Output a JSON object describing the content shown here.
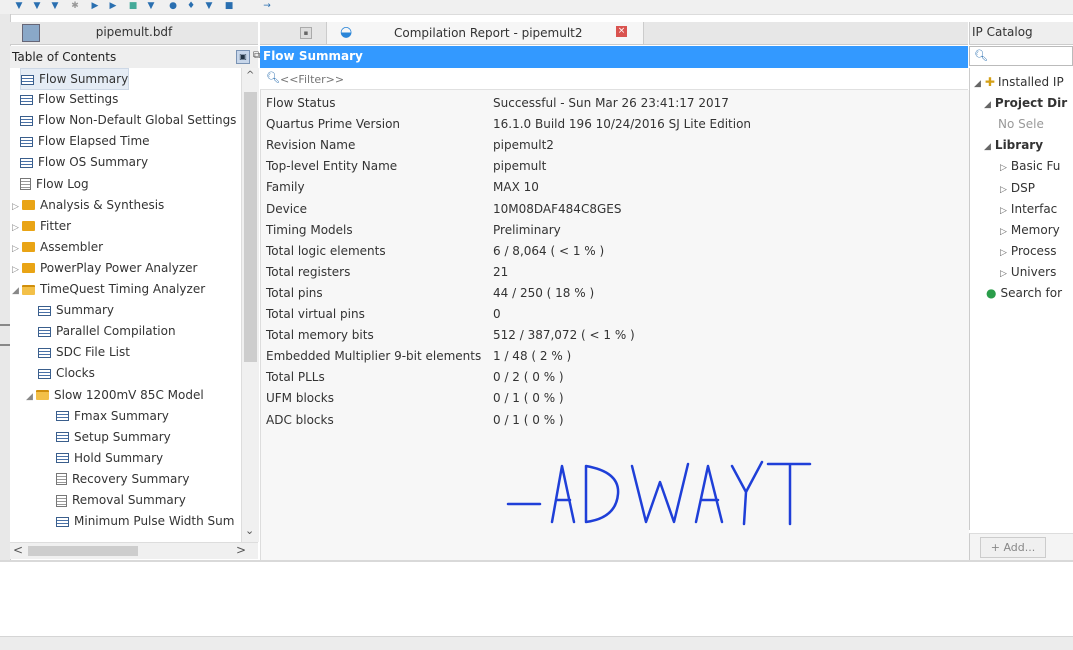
{
  "toolbar": {
    "icons": [
      "arrow-icon",
      "arrow-icon",
      "arrow-icon",
      "gear-icon",
      "play-icon",
      "play-icon",
      "chip-icon",
      "arrow-icon",
      "globe-icon",
      "pin-icon",
      "chart-icon",
      "save-icon",
      "arrow-icon"
    ]
  },
  "left_panel": {
    "tab_title": "pipemult.bdf",
    "toc_title": "Table of Contents",
    "items": [
      {
        "label": "Flow Summary",
        "icon": "table-icon",
        "selected": true
      },
      {
        "label": "Flow Settings",
        "icon": "table-icon"
      },
      {
        "label": "Flow Non-Default Global Settings",
        "icon": "table-icon"
      },
      {
        "label": "Flow Elapsed Time",
        "icon": "table-icon"
      },
      {
        "label": "Flow OS Summary",
        "icon": "table-icon"
      },
      {
        "label": "Flow Log",
        "icon": "document-icon"
      },
      {
        "label": "Analysis & Synthesis",
        "icon": "folder-icon",
        "arrow": "▷"
      },
      {
        "label": "Fitter",
        "icon": "folder-icon",
        "arrow": "▷"
      },
      {
        "label": "Assembler",
        "icon": "folder-icon",
        "arrow": "▷"
      },
      {
        "label": "PowerPlay Power Analyzer",
        "icon": "folder-icon",
        "arrow": "▷"
      },
      {
        "label": "TimeQuest Timing Analyzer",
        "icon": "folder-open-icon",
        "arrow": "◢"
      },
      {
        "label": "Summary",
        "icon": "table-icon"
      },
      {
        "label": "Parallel Compilation",
        "icon": "table-icon"
      },
      {
        "label": "SDC File List",
        "icon": "table-icon"
      },
      {
        "label": "Clocks",
        "icon": "table-icon"
      },
      {
        "label": "Slow 1200mV 85C Model",
        "icon": "folder-open-icon",
        "arrow": "◢"
      },
      {
        "label": "Fmax Summary",
        "icon": "table-icon"
      },
      {
        "label": "Setup Summary",
        "icon": "table-icon"
      },
      {
        "label": "Hold Summary",
        "icon": "table-icon"
      },
      {
        "label": "Recovery Summary",
        "icon": "document-icon"
      },
      {
        "label": "Removal Summary",
        "icon": "document-icon"
      },
      {
        "label": "Minimum Pulse Width Sum",
        "icon": "table-icon"
      }
    ]
  },
  "report": {
    "tab_title": "Compilation Report - pipemult2",
    "section_title": "Flow Summary",
    "filter_placeholder": "<<Filter>>",
    "rows": [
      {
        "key": "Flow Status",
        "value": "Successful - Sun Mar 26 23:41:17 2017"
      },
      {
        "key": "Quartus Prime Version",
        "value": "16.1.0 Build 196 10/24/2016 SJ Lite Edition"
      },
      {
        "key": "Revision Name",
        "value": "pipemult2"
      },
      {
        "key": "Top-level Entity Name",
        "value": "pipemult"
      },
      {
        "key": "Family",
        "value": "MAX 10"
      },
      {
        "key": "Device",
        "value": "10M08DAF484C8GES"
      },
      {
        "key": "Timing Models",
        "value": "Preliminary"
      },
      {
        "key": "Total logic elements",
        "value": "6 / 8,064 ( < 1 % )"
      },
      {
        "key": "Total registers",
        "value": "21"
      },
      {
        "key": "Total pins",
        "value": "44 / 250 ( 18 % )"
      },
      {
        "key": "Total virtual pins",
        "value": "0"
      },
      {
        "key": "Total memory bits",
        "value": "512 / 387,072 ( < 1 % )"
      },
      {
        "key": "Embedded Multiplier 9-bit elements",
        "value": "1 / 48 ( 2 % )"
      },
      {
        "key": "Total PLLs",
        "value": "0 / 2 ( 0 % )"
      },
      {
        "key": "UFM blocks",
        "value": "0 / 1 ( 0 % )"
      },
      {
        "key": "ADC blocks",
        "value": "0 / 1 ( 0 % )"
      }
    ],
    "signature": "-ADWAYT",
    "signature_color": "#1f3fd8",
    "header_color": "#3399ff"
  },
  "ip_catalog": {
    "title": "IP Catalog",
    "items": [
      {
        "label": "Installed IP",
        "arrow": "◢",
        "bold": false
      },
      {
        "label": "Project Dir",
        "arrow": "◢",
        "bold": true
      },
      {
        "label": "No Sele",
        "arrow": "",
        "bold": false
      },
      {
        "label": "Library",
        "arrow": "◢",
        "bold": true
      },
      {
        "label": "Basic Fu",
        "arrow": "▷",
        "bold": false
      },
      {
        "label": "DSP",
        "arrow": "▷",
        "bold": false
      },
      {
        "label": "Interfac",
        "arrow": "▷",
        "bold": false
      },
      {
        "label": "Memory",
        "arrow": "▷",
        "bold": false
      },
      {
        "label": "Process",
        "arrow": "▷",
        "bold": false
      },
      {
        "label": "Univers",
        "arrow": "▷",
        "bold": false
      },
      {
        "label": "Search for",
        "arrow": "",
        "bold": false
      }
    ],
    "add_label": "+ Add..."
  }
}
